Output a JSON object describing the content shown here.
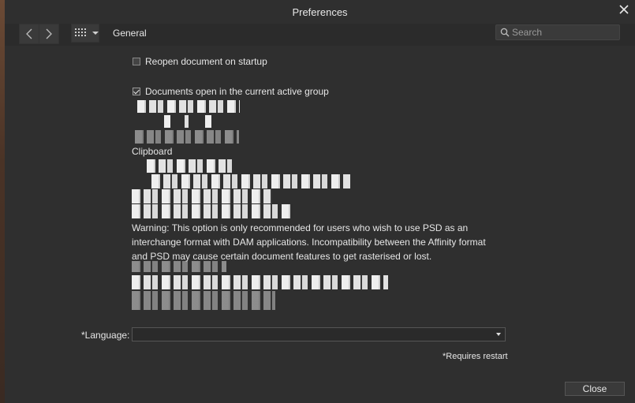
{
  "window": {
    "title": "Preferences"
  },
  "toolbar": {
    "section": "General",
    "search_placeholder": "Search"
  },
  "options": {
    "reopen_label": "Reopen document on startup",
    "reopen_checked": false,
    "open_in_group_label": "Documents open in the current active group",
    "open_in_group_checked": true
  },
  "clipboard": {
    "heading": "Clipboard"
  },
  "warning_text": "Warning: This option is only recommended for users who wish to use PSD as an interchange format with DAM applications. Incompatibility between the Affinity format and PSD may cause certain document features to get rasterised or lost.",
  "language": {
    "label": "*Language:",
    "selected": ""
  },
  "footer": {
    "requires_restart": "*Requires restart",
    "close_label": "Close"
  },
  "colors": {
    "background": "#2f2f2f",
    "text": "#e6e6e6",
    "control": "#3a3a3a"
  }
}
